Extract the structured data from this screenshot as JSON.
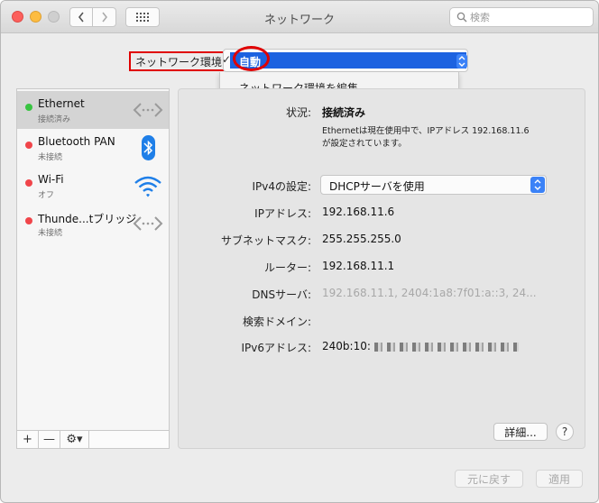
{
  "window": {
    "title": "ネットワーク"
  },
  "search": {
    "placeholder": "検索"
  },
  "location": {
    "label": "ネットワーク環境",
    "selected": "自動",
    "menu_item": "ネットワーク環境を編集..."
  },
  "services": [
    {
      "name": "Ethernet",
      "status": "接続済み",
      "status_color": "#38c441",
      "icon": "ethernet-icon",
      "selected": true
    },
    {
      "name": "Bluetooth PAN",
      "status": "未接続",
      "status_color": "#f0454a",
      "icon": "bluetooth-icon",
      "selected": false
    },
    {
      "name": "Wi-Fi",
      "status": "オフ",
      "status_color": "#f0454a",
      "icon": "wifi-icon",
      "selected": false
    },
    {
      "name": "Thunde...tブリッジ",
      "status": "未接続",
      "status_color": "#f0454a",
      "icon": "thunderbolt-bridge-icon",
      "selected": false
    }
  ],
  "sidebar_controls": {
    "add": "+",
    "remove": "—",
    "gear": "⚙▾"
  },
  "detail": {
    "status_label": "状況:",
    "status_value": "接続済み",
    "status_desc_line1": "Ethernetは現在使用中で、IPアドレス 192.168.11.6",
    "status_desc_line2": "が設定されています。",
    "ipv4_label": "IPv4の設定:",
    "ipv4_value": "DHCPサーバを使用",
    "ip_label": "IPアドレス:",
    "ip_value": "192.168.11.6",
    "subnet_label": "サブネットマスク:",
    "subnet_value": "255.255.255.0",
    "router_label": "ルーター:",
    "router_value": "192.168.11.1",
    "dns_label": "DNSサーバ:",
    "dns_value": "192.168.11.1, 2404:1a8:7f01:a::3, 24...",
    "search_domain_label": "検索ドメイン:",
    "search_domain_value": "",
    "ipv6_label": "IPv6アドレス:",
    "ipv6_value": "240b:10:"
  },
  "buttons": {
    "detail": "詳細...",
    "help": "?",
    "revert": "元に戻す",
    "apply": "適用"
  },
  "colors": {
    "accent": "#1c62e0",
    "highlight_box": "#e00000"
  }
}
